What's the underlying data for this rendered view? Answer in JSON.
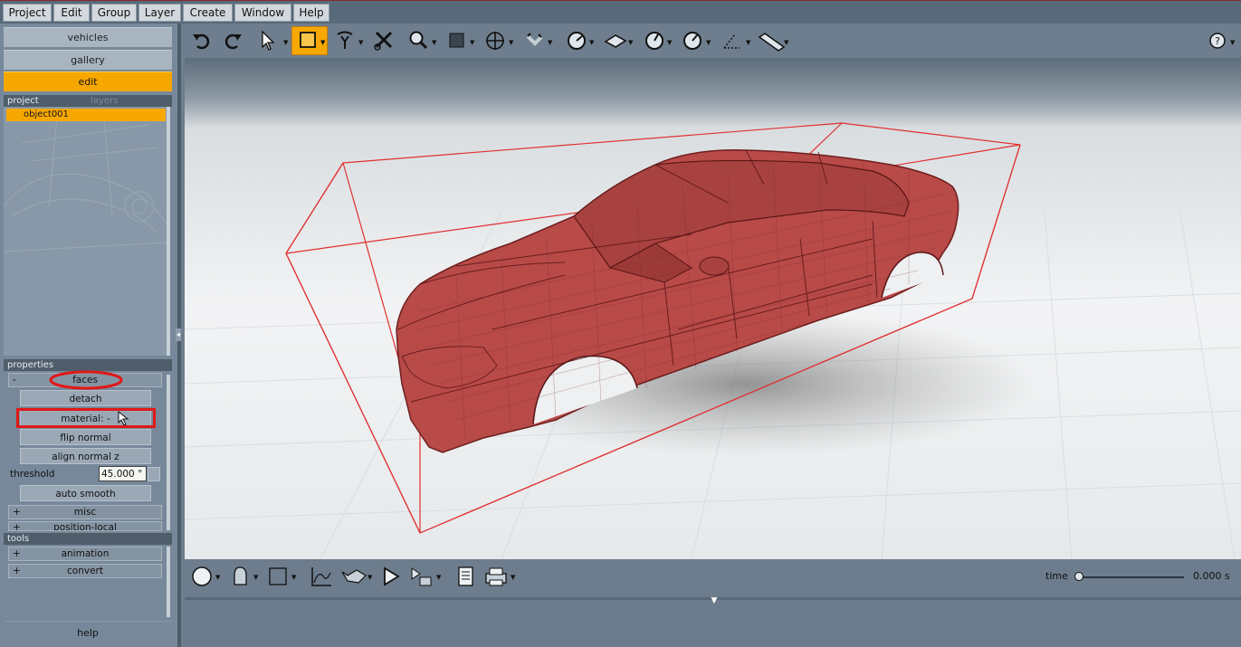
{
  "menu": [
    "Project",
    "Edit",
    "Group",
    "Layer",
    "Create",
    "Window",
    "Help"
  ],
  "left_panel": {
    "tabs": {
      "vehicles": "vehicles",
      "gallery": "gallery",
      "edit": "edit"
    },
    "project_header": {
      "project": "project",
      "layers": "layers"
    },
    "project_items": [
      "object001"
    ],
    "properties_header": "properties",
    "faces_group": {
      "sign": "-",
      "label": "faces"
    },
    "buttons": {
      "detach": "detach",
      "material": "material: -",
      "flip_normal": "flip normal",
      "align_normal_z": "align normal z",
      "auto_smooth": "auto smooth"
    },
    "threshold": {
      "label": "threshold",
      "value": "45.000 °"
    },
    "misc_group": {
      "sign": "+",
      "label": "misc"
    },
    "position_group": {
      "sign": "+",
      "label": "position-local"
    },
    "tools_header": "tools",
    "animation_group": {
      "sign": "+",
      "label": "animation"
    },
    "convert_group": {
      "sign": "+",
      "label": "convert"
    },
    "help": "help"
  },
  "bottom_bar": {
    "time_label": "time",
    "time_value": "0.000 s"
  },
  "colors": {
    "accent": "#f7a800",
    "selection_highlight": "#e01818",
    "model_fill": "#b84a48",
    "bounding_box": "#e03030"
  },
  "icons": {
    "toolbar": [
      "undo-icon",
      "redo-icon",
      "select-arrow-icon",
      "select-rectangle-icon",
      "lasso-icon",
      "cut-icon",
      "zoom-icon",
      "square-icon",
      "move-icon",
      "magnet-icon",
      "rotate-icon",
      "plane-icon",
      "scale-icon",
      "measure-icon",
      "angle-icon",
      "ruler-icon",
      "help-icon"
    ],
    "bottom": [
      "sphere-icon",
      "head-icon",
      "box-icon",
      "graph-icon",
      "camera-icon",
      "play-icon",
      "render-icon",
      "document-icon",
      "print-icon"
    ]
  }
}
